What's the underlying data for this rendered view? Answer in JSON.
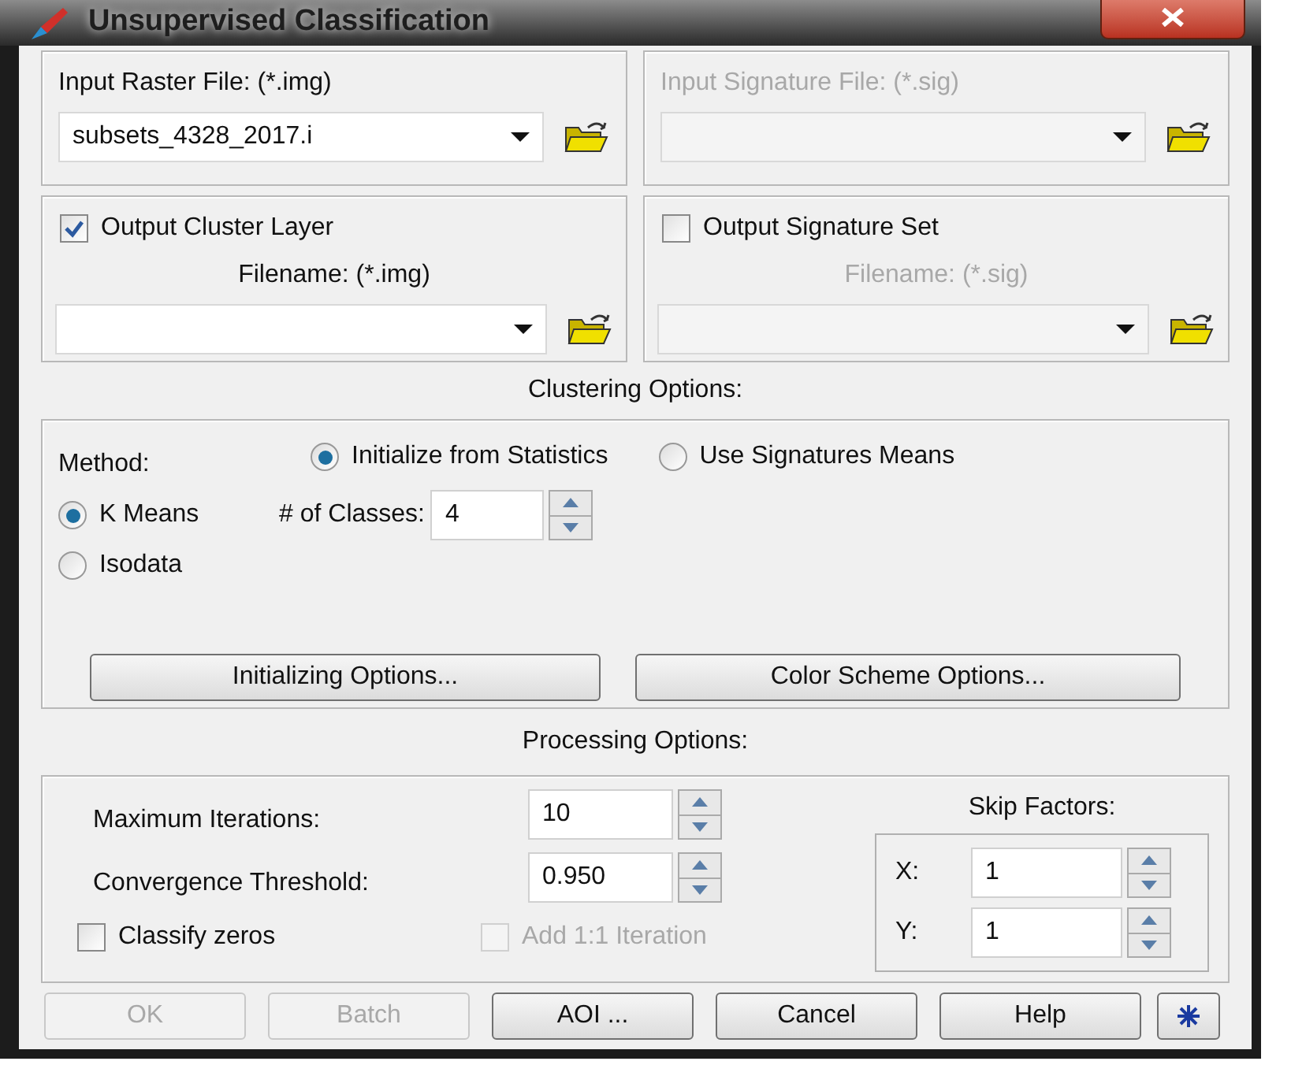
{
  "window": {
    "title": "Unsupervised Classification"
  },
  "input_raster": {
    "label": "Input Raster File: (*.img)",
    "value": "subsets_4328_2017.i",
    "disabled": false
  },
  "input_signature": {
    "label": "Input Signature File: (*.sig)",
    "disabled": true
  },
  "output_cluster": {
    "label": "Output Cluster Layer",
    "checked": true,
    "filename_label": "Filename: (*.img)",
    "disabled": false
  },
  "output_signature": {
    "label": "Output Signature Set",
    "checked": false,
    "filename_label": "Filename: (*.sig)",
    "disabled": true
  },
  "clustering": {
    "heading": "Clustering Options:",
    "method_label": "Method:",
    "init_options": [
      {
        "label": "Initialize from Statistics",
        "selected": true
      },
      {
        "label": "Use Signatures Means",
        "selected": false
      }
    ],
    "algorithms": [
      {
        "label": "K Means",
        "selected": true
      },
      {
        "label": "Isodata",
        "selected": false
      }
    ],
    "classes_label": "# of Classes:",
    "classes_value": "4",
    "buttons": [
      "Initializing Options...",
      "Color Scheme Options..."
    ]
  },
  "processing": {
    "heading": "Processing Options:",
    "max_iterations": {
      "label": "Maximum Iterations:",
      "value": "10"
    },
    "convergence": {
      "label": "Convergence Threshold:",
      "value": "0.950"
    },
    "classify_zeros": {
      "label": "Classify zeros",
      "checked": false,
      "disabled": false
    },
    "add_iteration": {
      "label": "Add 1:1 Iteration",
      "checked": false,
      "disabled": true
    },
    "skip_factors": {
      "heading": "Skip Factors:",
      "x_label": "X:",
      "x_value": "1",
      "y_label": "Y:",
      "y_value": "1"
    }
  },
  "buttons": [
    {
      "label": "OK",
      "disabled": true
    },
    {
      "label": "Batch",
      "disabled": true
    },
    {
      "label": "AOI ...",
      "disabled": false
    },
    {
      "label": "Cancel",
      "disabled": false
    },
    {
      "label": "Help",
      "disabled": false
    }
  ]
}
